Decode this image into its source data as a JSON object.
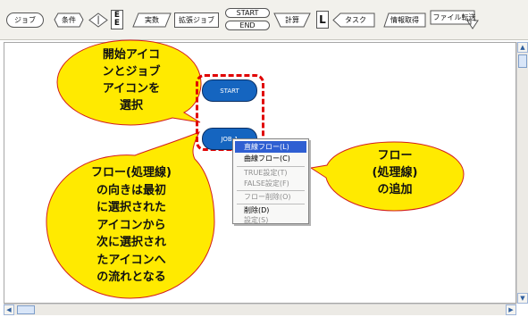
{
  "toolbar": {
    "items": [
      {
        "label": "ジョブ"
      },
      {
        "label": "条件"
      },
      {
        "label": "|"
      },
      {
        "label": "E\nE"
      },
      {
        "label": "実数"
      },
      {
        "label": "拡張ジョブ"
      },
      {
        "label": "START"
      },
      {
        "label": "END"
      },
      {
        "label": "計算"
      },
      {
        "label": "L"
      },
      {
        "label": "タスク"
      },
      {
        "label": "情報取得"
      },
      {
        "label": "ファイル転送"
      }
    ]
  },
  "canvas": {
    "start_label": "START",
    "job_label": "JOB-1"
  },
  "context_menu": {
    "items": [
      {
        "label": "直線フロー(L)"
      },
      {
        "label": "曲線フロー(C)"
      },
      {
        "label": "TRUE設定(T)"
      },
      {
        "label": "FALSE設定(F)"
      },
      {
        "label": "フロー削除(O)"
      },
      {
        "label": "削除(D)"
      },
      {
        "label": "設定(S)"
      }
    ]
  },
  "callouts": {
    "top_left": "開始アイコ\nンとジョブ\nアイコンを\n選択",
    "right": "フロー\n(処理線)\nの追加",
    "bottom_left": "フロー(処理線)\nの向きは最初\nに選択された\nアイコンから\n次に選択され\nたアイコンへ\nの流れとなる"
  },
  "colors": {
    "callout_fill": "#ffea00",
    "callout_stroke": "#d31d1d",
    "job_fill": "#1565c0",
    "menu_highlight": "#2f5fd2"
  }
}
